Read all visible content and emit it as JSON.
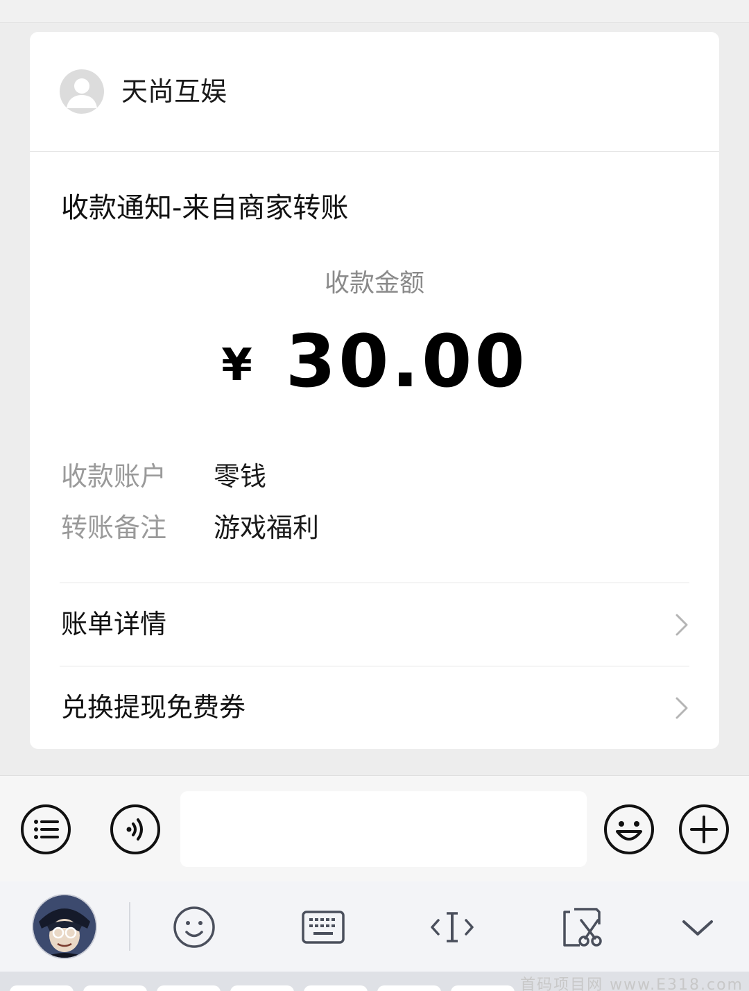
{
  "card": {
    "sender_name": "天尚互娱",
    "notice_title": "收款通知-来自商家转账",
    "amount_label": "收款金额",
    "currency_symbol": "¥",
    "amount": "30.00",
    "details": [
      {
        "label": "收款账户",
        "value": "零钱"
      },
      {
        "label": "转账备注",
        "value": "游戏福利"
      }
    ],
    "links": [
      {
        "label": "账单详情"
      },
      {
        "label": "兑换提现免费券"
      }
    ]
  },
  "input_bar": {
    "icons": [
      "list-icon",
      "voice-icon",
      "emoji-icon",
      "plus-icon"
    ],
    "text_value": ""
  },
  "keyboard_toolbar": {
    "icons": [
      "avatar",
      "smiley-icon",
      "keyboard-icon",
      "cursor-icon",
      "clipboard-scissors-icon",
      "chevron-down-icon"
    ]
  },
  "watermark": "首码项目网 www.E318.com",
  "colors": {
    "background": "#ededed",
    "card": "#ffffff",
    "muted_text": "#8a8a8a",
    "primary_text": "#111111"
  }
}
